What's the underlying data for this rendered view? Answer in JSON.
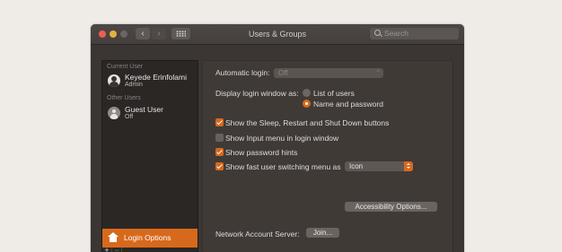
{
  "window": {
    "title": "Users & Groups"
  },
  "search": {
    "placeholder": "Search"
  },
  "sidebar": {
    "current_user_label": "Current User",
    "other_users_label": "Other Users",
    "users": [
      {
        "name": "Keyede Erinfolami",
        "role": "Admin",
        "avatar": "photo"
      },
      {
        "name": "Guest User",
        "role": "Off",
        "avatar": "guest-icon"
      }
    ],
    "login_options_label": "Login Options",
    "add_symbol": "+",
    "remove_symbol": "−"
  },
  "panel": {
    "automatic_login_label": "Automatic login:",
    "automatic_login_value": "Off",
    "display_login_label": "Display login window as:",
    "radio_list": "List of users",
    "radio_name": "Name and password",
    "radio_selected": "Name and password",
    "checkboxes": [
      {
        "label": "Show the Sleep, Restart and Shut Down buttons",
        "checked": true
      },
      {
        "label": "Show Input menu in login window",
        "checked": false
      },
      {
        "label": "Show password hints",
        "checked": true
      },
      {
        "label": "Show fast user switching menu as",
        "checked": true
      }
    ],
    "fast_switch_value": "Icon",
    "accessibility_button": "Accessibility Options...",
    "network_label": "Network Account Server:",
    "join_button": "Join..."
  },
  "colors": {
    "accent": "#d7691c",
    "window_bg": "#3b3633",
    "close": "#ec5f57",
    "minimize": "#e0b33c"
  }
}
